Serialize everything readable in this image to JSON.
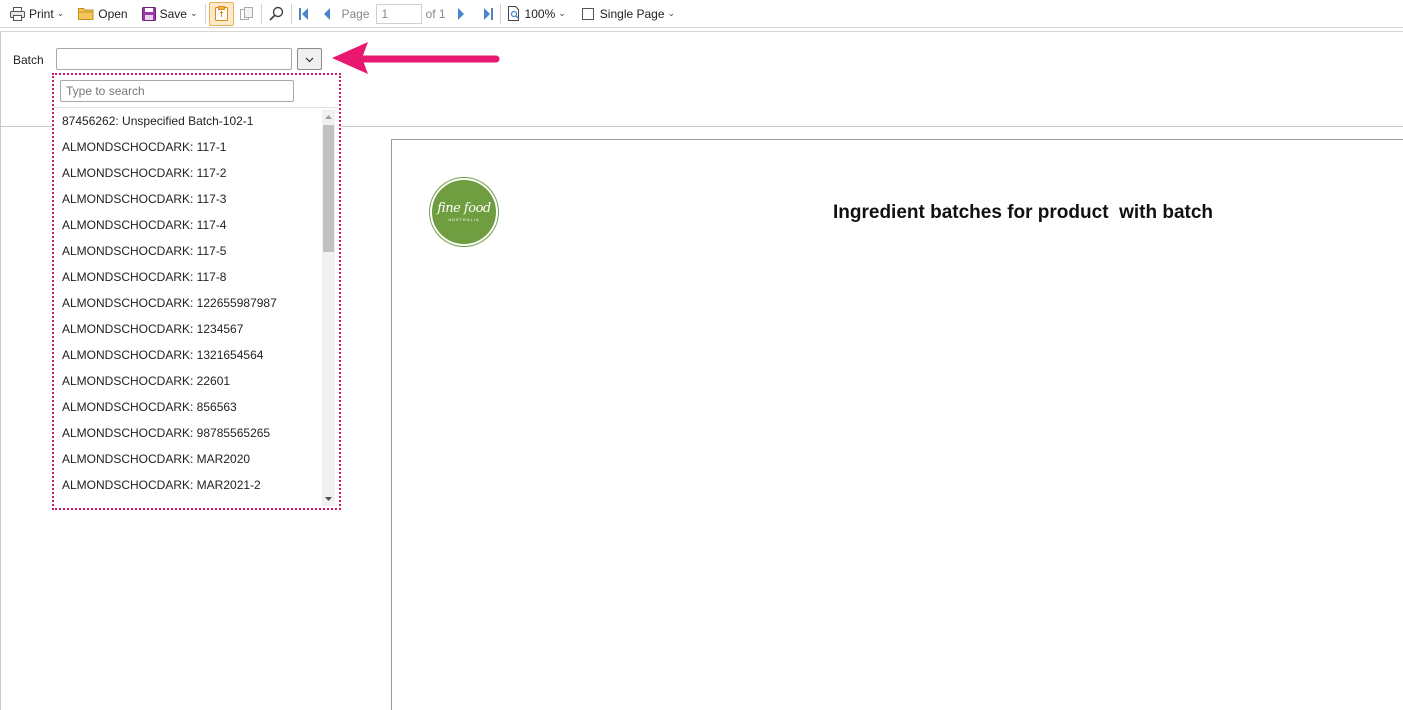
{
  "toolbar": {
    "print_label": "Print",
    "open_label": "Open",
    "save_label": "Save",
    "page_label": "Page",
    "page_value": "1",
    "page_of": "of 1",
    "zoom_label": "100%",
    "view_mode_label": "Single Page"
  },
  "params": {
    "batch_label": "Batch",
    "batch_value": ""
  },
  "dropdown": {
    "search_placeholder": "Type to search",
    "items": [
      "87456262: Unspecified Batch-102-1",
      "ALMONDSCHOCDARK: 117-1",
      "ALMONDSCHOCDARK: 117-2",
      "ALMONDSCHOCDARK: 117-3",
      "ALMONDSCHOCDARK: 117-4",
      "ALMONDSCHOCDARK: 117-5",
      "ALMONDSCHOCDARK: 117-8",
      "ALMONDSCHOCDARK: 122655987987",
      "ALMONDSCHOCDARK: 1234567",
      "ALMONDSCHOCDARK: 1321654564",
      "ALMONDSCHOCDARK: 22601",
      "ALMONDSCHOCDARK: 856563",
      "ALMONDSCHOCDARK: 98785565265",
      "ALMONDSCHOCDARK: MAR2020",
      "ALMONDSCHOCDARK: MAR2021-2"
    ]
  },
  "report": {
    "title": "Ingredient batches for product  with batch",
    "logo_text": "fine food",
    "logo_subtext": "AUSTRALIA"
  },
  "colors": {
    "annotation": "#e8176f",
    "logo_green": "#6e9e3f",
    "nav_blue": "#4a86c8"
  }
}
